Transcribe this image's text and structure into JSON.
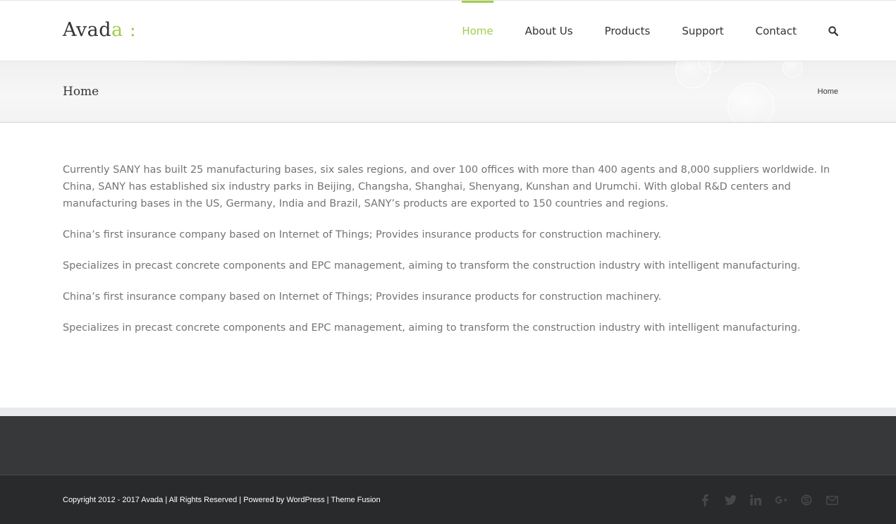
{
  "header": {
    "logo": {
      "text_main": "Avad",
      "text_accent": "a :"
    },
    "nav": [
      {
        "label": "Home",
        "active": true
      },
      {
        "label": "About Us",
        "active": false
      },
      {
        "label": "Products",
        "active": false
      },
      {
        "label": "Support",
        "active": false
      },
      {
        "label": "Contact",
        "active": false
      }
    ],
    "search_icon": "search-icon"
  },
  "title_bar": {
    "title": "Home",
    "breadcrumb": "Home"
  },
  "content": {
    "paragraphs": [
      "Currently SANY has built 25 manufacturing bases, six sales regions, and over 100 offices with more than 400 agents and 8,000 suppliers worldwide. In China, SANY has established six industry parks in Beijing, Changsha, Shanghai, Shenyang, Kunshan and Urumchi. With global R&D centers and manufacturing bases in the US, Germany, India and Brazil, SANY’s products are exported to 150 countries and regions.",
      "China’s first insurance company based on Internet of Things; Provides insurance products for construction machinery.",
      "Specializes in precast concrete components and EPC management, aiming to transform the construction industry with intelligent manufacturing.",
      "China’s first insurance company based on Internet of Things; Provides insurance products for construction machinery.",
      "Specializes in precast concrete components and EPC management, aiming to transform the construction industry with intelligent manufacturing."
    ]
  },
  "footer": {
    "copyright": {
      "prefix": "Copyright 2012 - 2017 Avada | All Rights Reserved | Powered by ",
      "link1": "WordPress",
      "sep": " | ",
      "link2": "Theme Fusion"
    },
    "social_icons": [
      "facebook-icon",
      "twitter-icon",
      "linkedin-icon",
      "google-plus-icon",
      "skype-icon",
      "email-icon"
    ]
  },
  "colors": {
    "accent": "#a0ce4e",
    "text": "#747474",
    "heading": "#333333",
    "footer_bg": "#363839",
    "copyright_bg": "#282a2b"
  }
}
